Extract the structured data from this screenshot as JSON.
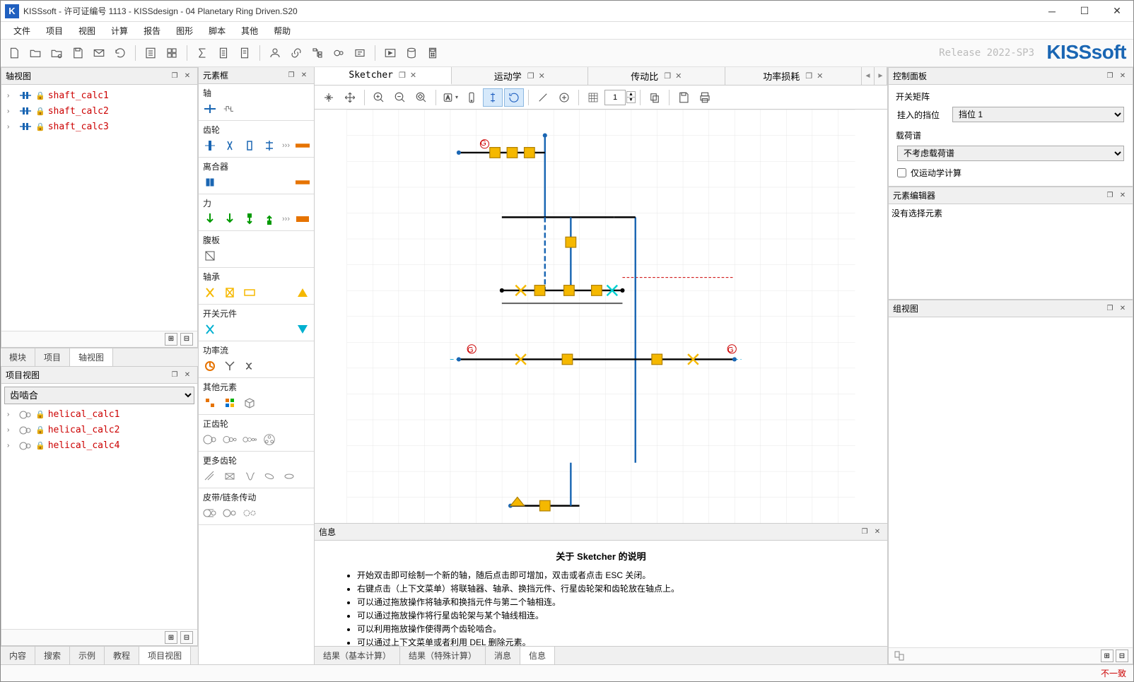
{
  "titlebar": {
    "app_logo": "K",
    "title": "KISSsoft - 许可证编号 1113 - KISSdesign - 04 Planetary Ring Driven.S20"
  },
  "menubar": [
    "文件",
    "项目",
    "视图",
    "计算",
    "报告",
    "图形",
    "脚本",
    "其他",
    "帮助"
  ],
  "release": "Release 2022-SP3",
  "brand": "KISSsoft",
  "left": {
    "shaft_panel": {
      "title": "轴视图",
      "items": [
        "shaft_calc1",
        "shaft_calc2",
        "shaft_calc3"
      ]
    },
    "shaft_tabs": [
      "模块",
      "项目",
      "轴视图"
    ],
    "project_panel": {
      "title": "项目视图",
      "select_value": "齿啮合",
      "items": [
        "helical_calc1",
        "helical_calc2",
        "helical_calc4"
      ]
    },
    "bottom_tabs": [
      "内容",
      "搜索",
      "示例",
      "教程",
      "项目视图"
    ]
  },
  "elementbox": {
    "title": "元素框",
    "sections": [
      "轴",
      "齿轮",
      "离合器",
      "力",
      "腹板",
      "轴承",
      "开关元件",
      "功率流",
      "其他元素",
      "正齿轮",
      "更多齿轮",
      "皮带/链条传动"
    ]
  },
  "center": {
    "tabs": [
      "Sketcher",
      "运动学",
      "传动比",
      "功率损耗"
    ],
    "active_tab": 0,
    "spin_value": "1"
  },
  "info": {
    "title": "信息",
    "heading": "关于 Sketcher 的说明",
    "bullets": [
      "开始双击即可绘制一个新的轴，随后点击即可增加，双击或者点击 ESC 关闭。",
      "右键点击（上下文菜单）将联轴器、轴承、换挡元件、行星齿轮架和齿轮放在轴点上。",
      "可以通过拖放操作将轴承和换挡元件与第二个轴相连。",
      "可以通过拖放操作将行星齿轮架与某个轴线相连。",
      "可以利用拖放操作使得两个齿轮啮合。",
      "可以通过上下文菜单或者利用 DEL 删除元素。"
    ],
    "bottom_tabs": [
      "结果（基本计算）",
      "结果（特殊计算）",
      "消息",
      "信息"
    ]
  },
  "right": {
    "control_panel": {
      "title": "控制面板",
      "sw_matrix": "开关矩阵",
      "gear_label": "挂入的挡位",
      "gear_value": "挡位 1",
      "load_spec_label": "载荷谱",
      "load_spec_value": "不考虑载荷谱",
      "kin_only": "仅运动学计算"
    },
    "elem_editor": {
      "title": "元素编辑器",
      "msg": "没有选择元素"
    },
    "group_view": {
      "title": "组视图"
    }
  },
  "status": "不一致"
}
